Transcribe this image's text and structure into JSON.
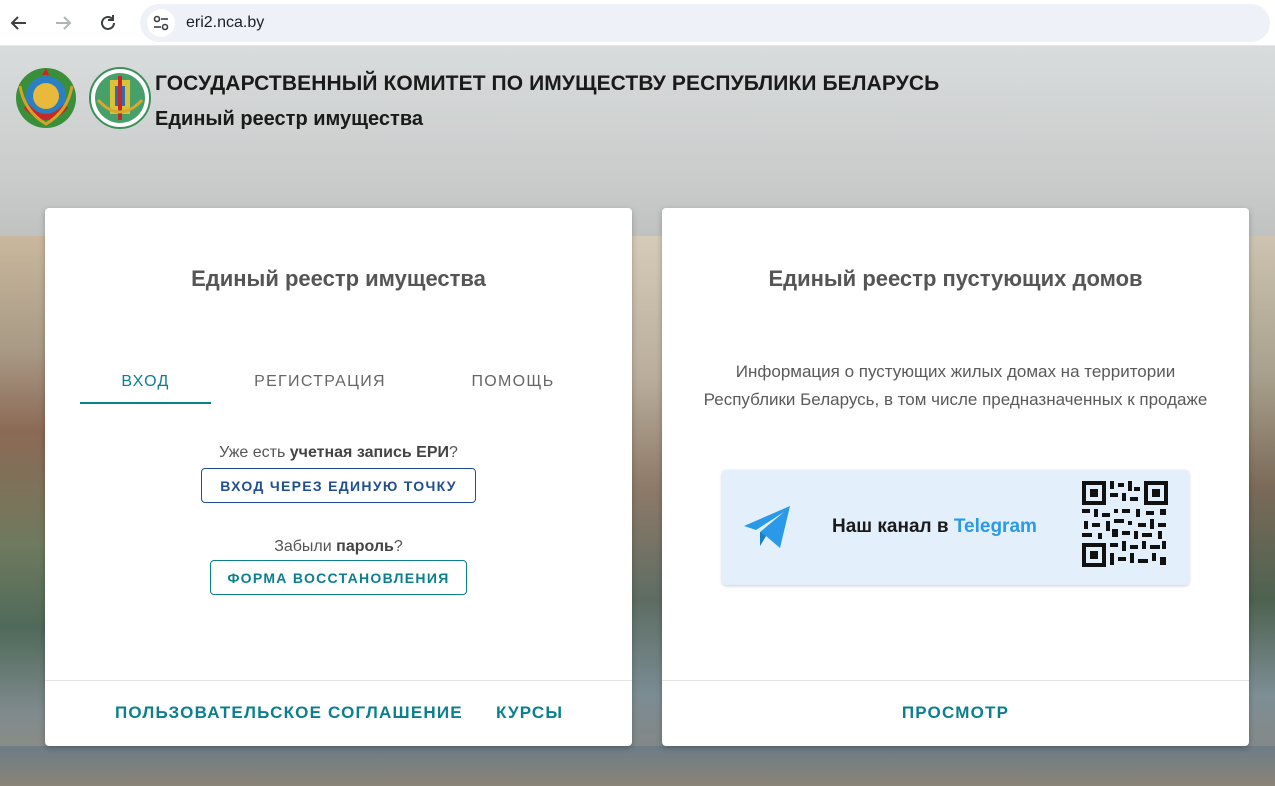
{
  "browser": {
    "url": "eri2.nca.by"
  },
  "header": {
    "title": "ГОСУДАРСТВЕННЫЙ КОМИТЕТ ПО ИМУЩЕСТВУ РЕСПУБЛИКИ БЕЛАРУСЬ",
    "subtitle": "Единый реестр имущества"
  },
  "left_card": {
    "title": "Единый реестр имущества",
    "tabs": [
      {
        "label": "ВХОД",
        "active": true
      },
      {
        "label": "РЕГИСТРАЦИЯ",
        "active": false
      },
      {
        "label": "ПОМОЩЬ",
        "active": false
      }
    ],
    "account_prompt": {
      "prefix": "Уже есть ",
      "bold": "учетная запись ЕРИ",
      "suffix": "?"
    },
    "sso_button": "ВХОД ЧЕРЕЗ ЕДИНУЮ ТОЧКУ",
    "password_prompt": {
      "prefix": "Забыли ",
      "bold": "пароль",
      "suffix": "?"
    },
    "restore_button": "ФОРМА ВОССТАНОВЛЕНИЯ",
    "footer_links": [
      "ПОЛЬЗОВАТЕЛЬСКОЕ СОГЛАШЕНИЕ",
      "КУРСЫ"
    ]
  },
  "right_card": {
    "title": "Единый реестр пустующих домов",
    "description": "Информация о пустующих жилых домах на территории Республики Беларусь, в том числе предназначенных к продаже",
    "telegram": {
      "prefix": "Наш канал в ",
      "brand": "Telegram"
    },
    "footer_link": "ПРОСМОТР"
  },
  "colors": {
    "accent": "#0b7f8e",
    "sso_border": "#1f4f8f",
    "telegram_blue": "#2a9ae8",
    "telegram_bg": "#e3f0fb"
  }
}
